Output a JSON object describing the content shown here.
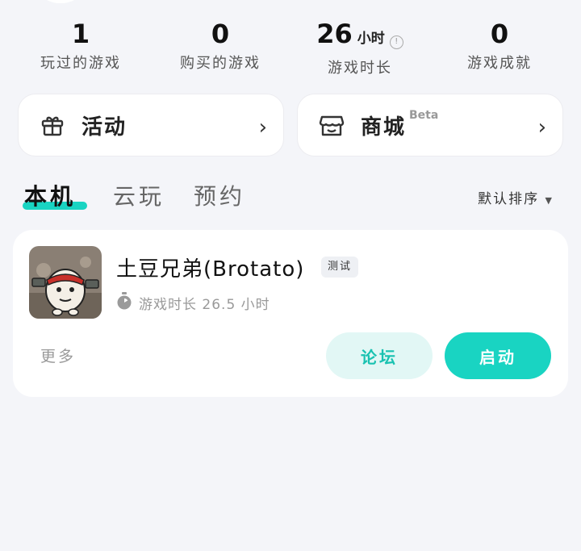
{
  "stats": [
    {
      "value": "1",
      "label": "玩过的游戏"
    },
    {
      "value": "0",
      "label": "购买的游戏"
    },
    {
      "value": "26",
      "unit": "小时",
      "label": "游戏时长",
      "info_icon": "info-icon"
    },
    {
      "value": "0",
      "label": "游戏成就"
    }
  ],
  "quick_links": {
    "activity": {
      "label": "活动",
      "icon": "gift-icon"
    },
    "store": {
      "label": "商城",
      "badge": "Beta",
      "icon": "shop-icon"
    }
  },
  "tabs": [
    {
      "label": "本机",
      "active": true
    },
    {
      "label": "云玩",
      "active": false
    },
    {
      "label": "预约",
      "active": false
    }
  ],
  "sort": {
    "label": "默认排序",
    "icon": "caret-down-icon"
  },
  "game": {
    "title": "土豆兄弟(Brotato)",
    "tag": "测试",
    "playtime_label": "游戏时长 26.5 小时",
    "more_label": "更多",
    "forum_button": "论坛",
    "launch_button": "启动"
  },
  "colors": {
    "accent": "#19d4c2",
    "background": "#f4f5f9"
  }
}
